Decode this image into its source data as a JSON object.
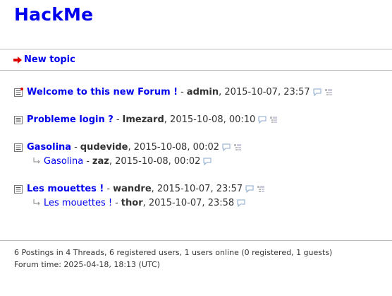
{
  "site": {
    "title": "HackMe"
  },
  "menu": {
    "new_topic": "New topic"
  },
  "threads": [
    {
      "title": "Welcome to this new Forum !",
      "author": "admin",
      "time": "2015-10-07, 23:57",
      "icon": "thread-new-icon",
      "replies": []
    },
    {
      "title": "Probleme login ?",
      "author": "Imezard",
      "time": "2015-10-08, 00:10",
      "icon": "thread-icon",
      "replies": []
    },
    {
      "title": "Gasolina",
      "author": "qudevide",
      "time": "2015-10-08, 00:02",
      "icon": "thread-icon",
      "replies": [
        {
          "title": "Gasolina",
          "author": "zaz",
          "time": "2015-10-08, 00:02"
        }
      ]
    },
    {
      "title": "Les mouettes !",
      "author": "wandre",
      "time": "2015-10-07, 23:57",
      "icon": "thread-icon",
      "replies": [
        {
          "title": "Les mouettes !",
          "author": "thor",
          "time": "2015-10-07, 23:58"
        }
      ]
    }
  ],
  "footer": {
    "stats": "6 Postings in 4 Threads, 6 registered users, 1 users online (0 registered, 1 guests)",
    "time": "Forum time: 2025-04-18, 18:13 (UTC)"
  },
  "colors": {
    "link": "#0000ee",
    "text": "#333333",
    "separator": "#bbbbbb",
    "arrow": "#dd0000"
  }
}
